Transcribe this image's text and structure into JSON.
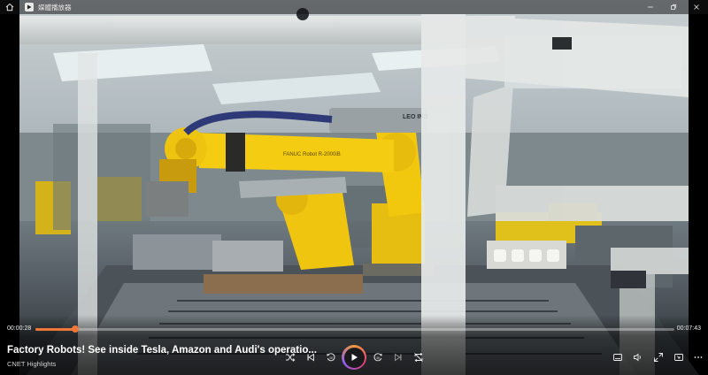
{
  "window": {
    "app_title": "媒體播放器"
  },
  "player": {
    "current_time": "00:00:28",
    "total_time": "00:07:43",
    "progress": 0.063,
    "title": "Factory Robots! See inside Tesla, Amazon and Audi's operatio...",
    "subtitle": "CNET Highlights"
  },
  "video_frame": {
    "robot_label": "FANUC Robot R-2000iB",
    "robot_badge": "LEO IND"
  },
  "colors": {
    "accent": "#f0793a",
    "robot_yellow": "#f2c80f",
    "play_gradient": [
      "#f29a3a",
      "#e0407a",
      "#8a5cf0"
    ]
  },
  "icons": {
    "home": "home-icon",
    "app": "play-icon",
    "minimize": "minimize-icon",
    "maximize": "maximize-icon",
    "close": "close-icon",
    "shuffle": "shuffle-icon",
    "previous": "previous-icon",
    "rewind": "rewind-10-icon",
    "play": "play-icon",
    "forward": "forward-30-icon",
    "next": "next-icon",
    "repeat": "repeat-off-icon",
    "caption": "caption-icon",
    "volume": "volume-icon",
    "fullscreen": "fullscreen-icon",
    "miniplayer": "miniplayer-icon",
    "more": "more-icon"
  }
}
